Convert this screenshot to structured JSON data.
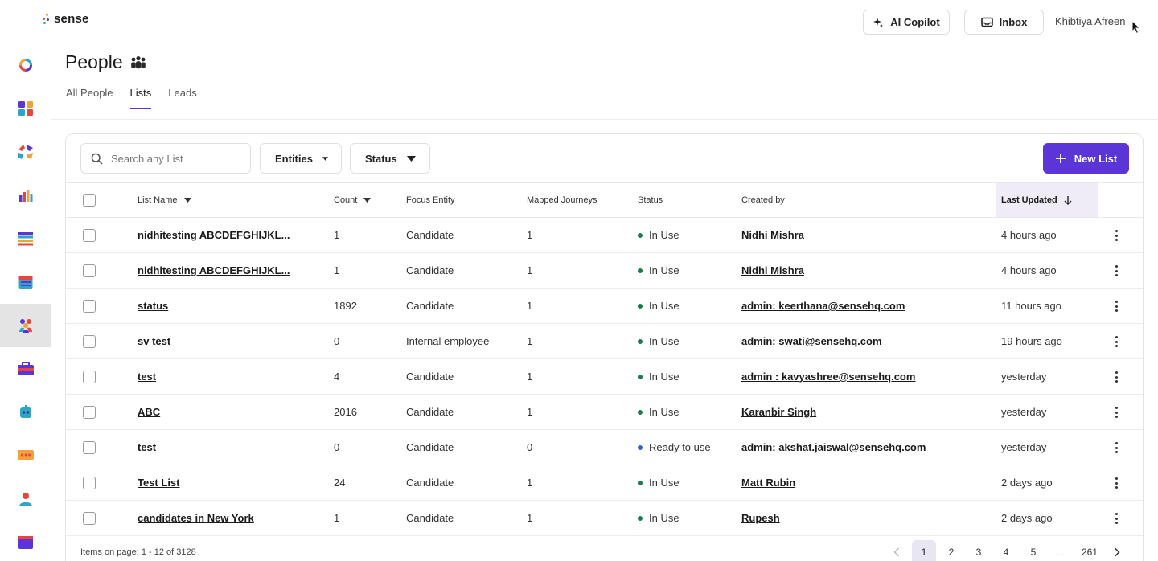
{
  "app": {
    "logo_text": "sense"
  },
  "header": {
    "copilot_label": "AI Copilot",
    "inbox_label": "Inbox",
    "user_name": "Khibtiya Afreen"
  },
  "sidebar": {
    "items": [
      {
        "name": "dashboard-ring",
        "active": false
      },
      {
        "name": "apps-grid",
        "active": false
      },
      {
        "name": "integrations",
        "active": false
      },
      {
        "name": "analytics",
        "active": false
      },
      {
        "name": "lists",
        "active": false
      },
      {
        "name": "calendar",
        "active": false
      },
      {
        "name": "people",
        "active": true
      },
      {
        "name": "jobs",
        "active": false
      },
      {
        "name": "bots",
        "active": false
      },
      {
        "name": "messages",
        "active": false
      },
      {
        "name": "contacts",
        "active": false
      },
      {
        "name": "templates",
        "active": false
      }
    ]
  },
  "page": {
    "title": "People",
    "tabs": [
      {
        "label": "All People",
        "active": false
      },
      {
        "label": "Lists",
        "active": true
      },
      {
        "label": "Leads",
        "active": false
      }
    ]
  },
  "toolbar": {
    "search_placeholder": "Search any List",
    "entities_label": "Entities",
    "status_label": "Status",
    "new_list_label": "New List"
  },
  "table": {
    "columns": {
      "list_name": "List Name",
      "count": "Count",
      "focus_entity": "Focus Entity",
      "mapped_journeys": "Mapped Journeys",
      "status": "Status",
      "created_by": "Created by",
      "last_updated": "Last Updated"
    },
    "rows": [
      {
        "name": "nidhitesting ABCDEFGHIJKL...",
        "count": "1",
        "entity": "Candidate",
        "journeys": "1",
        "status": "In Use",
        "status_color": "#1b7a45",
        "creator": "Nidhi Mishra",
        "updated": "4 hours ago"
      },
      {
        "name": "nidhitesting ABCDEFGHIJKL...",
        "count": "1",
        "entity": "Candidate",
        "journeys": "1",
        "status": "In Use",
        "status_color": "#1b7a45",
        "creator": "Nidhi Mishra",
        "updated": "4 hours ago"
      },
      {
        "name": "status",
        "count": "1892",
        "entity": "Candidate",
        "journeys": "1",
        "status": "In Use",
        "status_color": "#1b7a45",
        "creator": "admin: keerthana@sensehq.com",
        "updated": "11 hours ago"
      },
      {
        "name": "sv test",
        "count": "0",
        "entity": "Internal employee",
        "journeys": "1",
        "status": "In Use",
        "status_color": "#1b7a45",
        "creator": "admin: swati@sensehq.com",
        "updated": "19 hours ago"
      },
      {
        "name": "test",
        "count": "4",
        "entity": "Candidate",
        "journeys": "1",
        "status": "In Use",
        "status_color": "#1b7a45",
        "creator": "admin : kavyashree@sensehq.com",
        "updated": "yesterday"
      },
      {
        "name": "ABC",
        "count": "2016",
        "entity": "Candidate",
        "journeys": "1",
        "status": "In Use",
        "status_color": "#1b7a45",
        "creator": "Karanbir Singh",
        "updated": "yesterday"
      },
      {
        "name": "test",
        "count": "0",
        "entity": "Candidate",
        "journeys": "0",
        "status": "Ready to use",
        "status_color": "#2f62c9",
        "creator": "admin: akshat.jaiswal@sensehq.com",
        "updated": "yesterday"
      },
      {
        "name": "Test List",
        "count": "24",
        "entity": "Candidate",
        "journeys": "1",
        "status": "In Use",
        "status_color": "#1b7a45",
        "creator": "Matt Rubin",
        "updated": "2 days ago"
      },
      {
        "name": "candidates in New York",
        "count": "1",
        "entity": "Candidate",
        "journeys": "1",
        "status": "In Use",
        "status_color": "#1b7a45",
        "creator": "Rupesh",
        "updated": "2 days ago"
      }
    ]
  },
  "footer": {
    "items_text": "Items on page: 1 - 12 of 3128",
    "pages": [
      "1",
      "2",
      "3",
      "4",
      "5",
      "...",
      "261"
    ],
    "current_page": "1"
  },
  "colors": {
    "accent": "#5b35d5",
    "in_use": "#1b7a45",
    "ready": "#2f62c9"
  }
}
